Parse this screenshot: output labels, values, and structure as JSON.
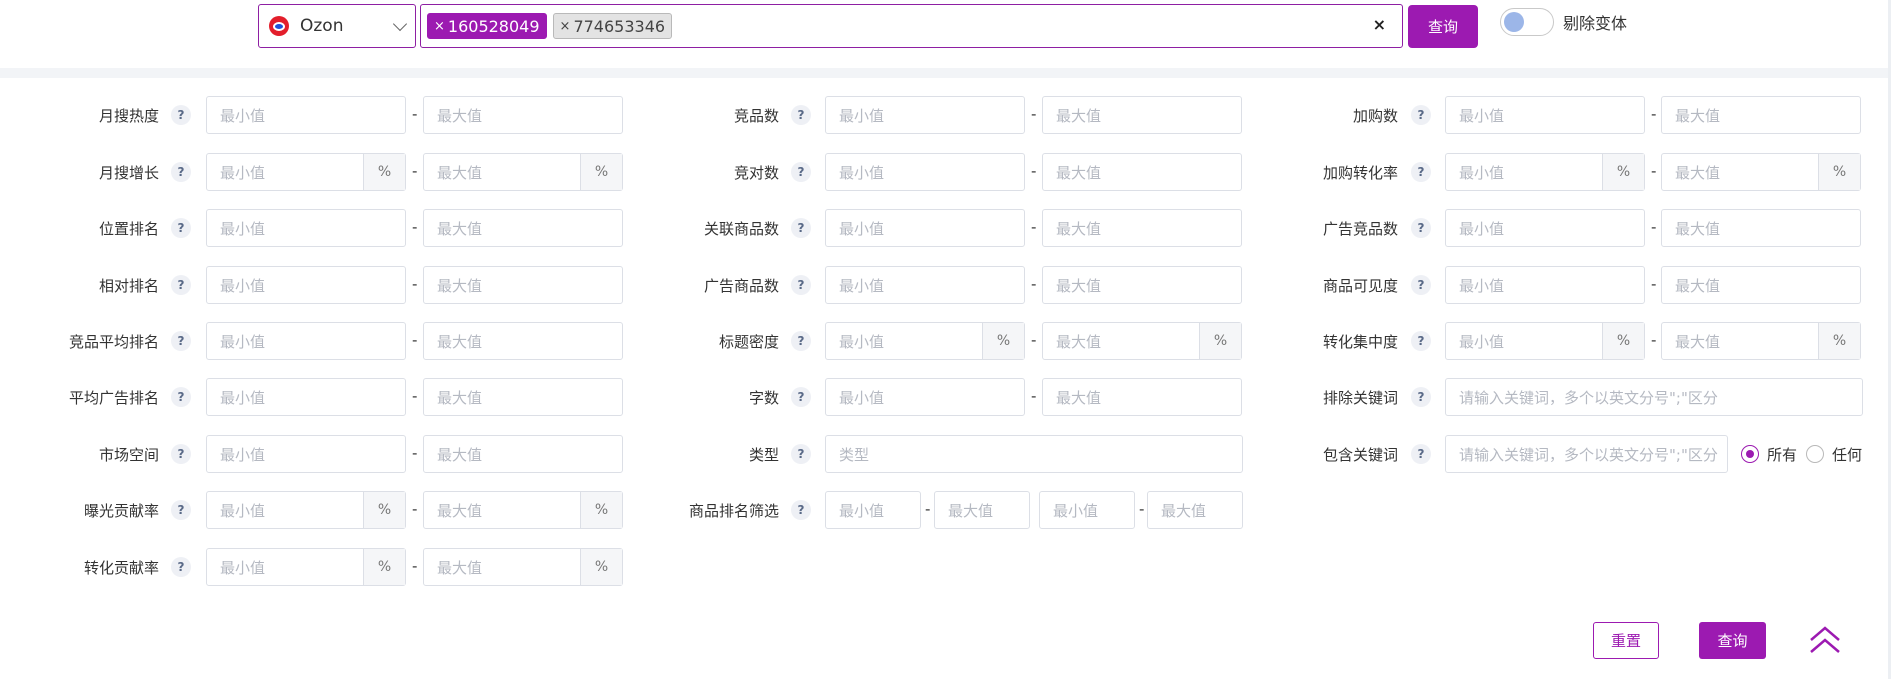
{
  "search": {
    "platform": "Ozon",
    "tags": [
      {
        "text": "160528049",
        "remove": "×",
        "active": true
      },
      {
        "text": "774653346",
        "remove": "×",
        "active": false
      }
    ],
    "clear_symbol": "×",
    "query_label": "查询",
    "toggle_label": "剔除变体",
    "toggle_on": false
  },
  "placeholders": {
    "min": "最小值",
    "max": "最大值",
    "type": "类型",
    "keyword": "请输入关键词，多个以英文分号\";\"区分"
  },
  "percent_symbol": "%",
  "dash": "-",
  "help_symbol": "?",
  "col1": [
    {
      "label": "月搜热度",
      "pct": false
    },
    {
      "label": "月搜增长",
      "pct": true
    },
    {
      "label": "位置排名",
      "pct": false
    },
    {
      "label": "相对排名",
      "pct": false
    },
    {
      "label": "竞品平均排名",
      "pct": false
    },
    {
      "label": "平均广告排名",
      "pct": false
    },
    {
      "label": "市场空间",
      "pct": false
    },
    {
      "label": "曝光贡献率",
      "pct": true
    },
    {
      "label": "转化贡献率",
      "pct": true
    }
  ],
  "col2": [
    {
      "label": "竞品数"
    },
    {
      "label": "竞对数"
    },
    {
      "label": "关联商品数"
    },
    {
      "label": "广告商品数"
    },
    {
      "label": "标题密度"
    },
    {
      "label": "字数"
    },
    {
      "label": "类型"
    },
    {
      "label": "商品排名筛选"
    }
  ],
  "col3": [
    {
      "label": "加购数"
    },
    {
      "label": "加购转化率"
    },
    {
      "label": "广告竞品数"
    },
    {
      "label": "商品可见度"
    },
    {
      "label": "转化集中度"
    },
    {
      "label": "排除关键词"
    },
    {
      "label": "包含关键词"
    }
  ],
  "keyword_match": {
    "options": [
      "所有",
      "任何"
    ],
    "selected": "所有"
  },
  "buttons": {
    "reset": "重置",
    "query": "查询"
  },
  "icons": {
    "scroll_top": "double-chevron-up-icon"
  },
  "colors": {
    "accent": "#9c1ab1",
    "ozon_red": "#e31e2b",
    "ozon_blue": "#1f53d8"
  }
}
